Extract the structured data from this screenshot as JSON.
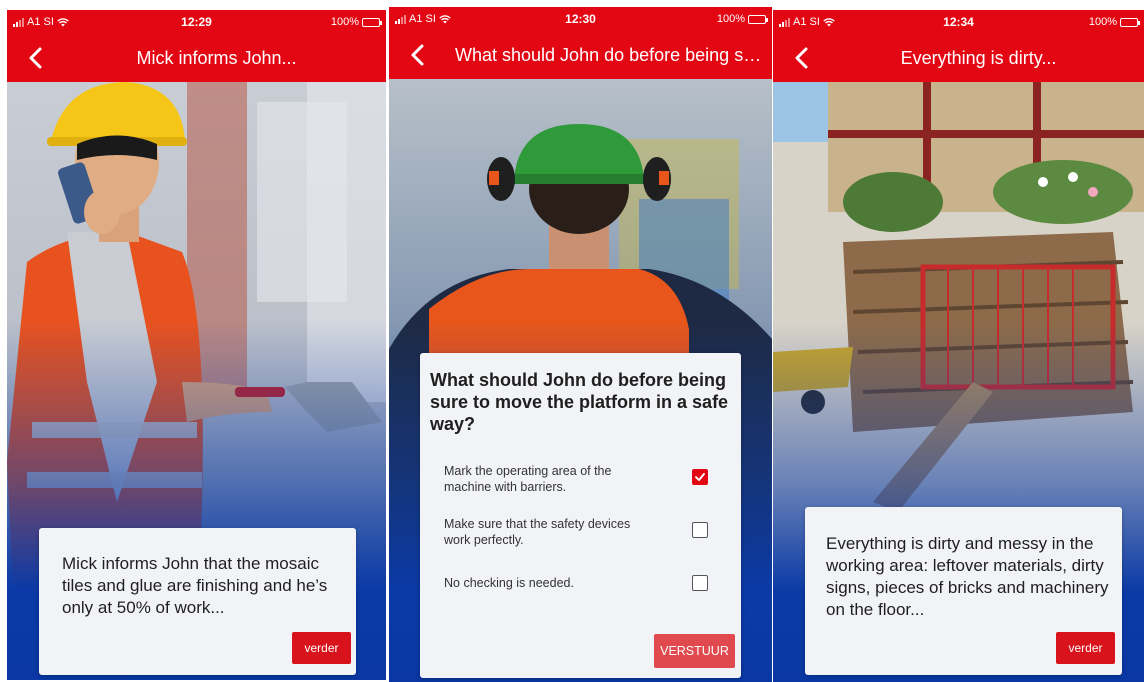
{
  "colors": {
    "accent_red": "#e30613",
    "button_red": "#d9131b",
    "brand_blue": "#0d3ea8",
    "card_background": "#f2f3f6"
  },
  "screens": [
    {
      "status": {
        "carrier": "A1 SI",
        "time": "12:29",
        "battery": "100%"
      },
      "nav": {
        "back_icon": "chevron-left-icon",
        "title": "Mick informs John..."
      },
      "card": {
        "text": "Mick informs John that the mosaic tiles and glue are finishing and he’s only at 50% of work...",
        "button": "verder"
      }
    },
    {
      "status": {
        "carrier": "A1 SI",
        "time": "12:30",
        "battery": "100%"
      },
      "nav": {
        "back_icon": "chevron-left-icon",
        "title": "What should John do before being su..."
      },
      "quiz": {
        "question": "What should John do before being sure to move the platform in a safe way?",
        "options": [
          {
            "label": "Mark the operating area of the machine with barriers.",
            "checked": true
          },
          {
            "label": "Make sure that the safety devices work perfectly.",
            "checked": false
          },
          {
            "label": "No checking is needed.",
            "checked": false
          }
        ],
        "submit": "VERSTUUR"
      }
    },
    {
      "status": {
        "carrier": "A1 SI",
        "time": "12:34",
        "battery": "100%"
      },
      "nav": {
        "back_icon": "chevron-left-icon",
        "title": "Everything is dirty..."
      },
      "card": {
        "text": "Everything is dirty and messy in the working area: leftover materials, dirty signs, pieces of bricks and machinery on the floor...",
        "button": "verder"
      }
    }
  ]
}
